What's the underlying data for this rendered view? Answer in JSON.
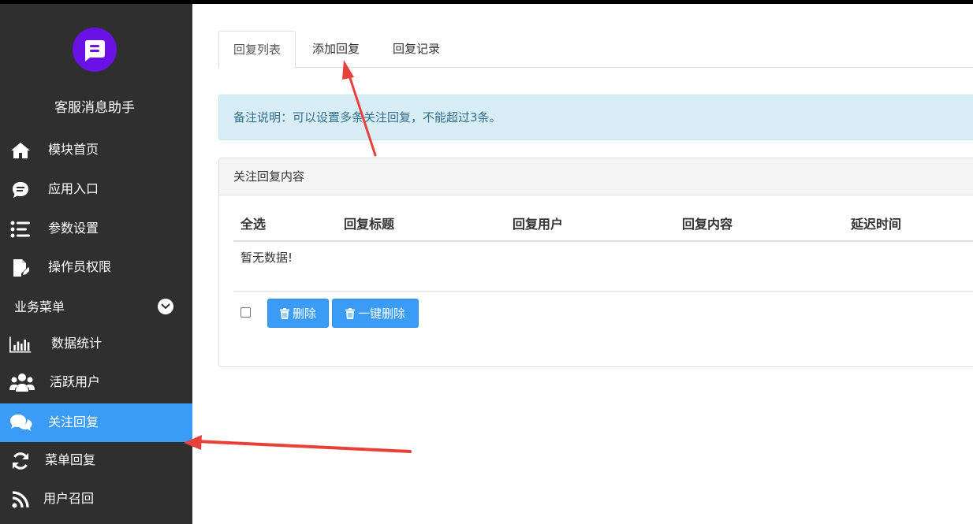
{
  "sidebar": {
    "app_name": "客服消息助手",
    "items": [
      {
        "label": "模块首页",
        "icon": "home-icon"
      },
      {
        "label": "应用入口",
        "icon": "chat-bubble-icon"
      },
      {
        "label": "参数设置",
        "icon": "list-settings-icon"
      },
      {
        "label": "操作员权限",
        "icon": "edit-document-icon"
      }
    ],
    "section_label": "业务菜单",
    "section_items": [
      {
        "label": "数据统计",
        "icon": "bar-chart-icon"
      },
      {
        "label": "活跃用户",
        "icon": "users-icon"
      },
      {
        "label": "关注回复",
        "icon": "comments-icon",
        "active": true
      },
      {
        "label": "菜单回复",
        "icon": "refresh-icon"
      },
      {
        "label": "用户召回",
        "icon": "rss-icon"
      }
    ]
  },
  "tabs": [
    {
      "label": "回复列表",
      "active": true
    },
    {
      "label": "添加回复"
    },
    {
      "label": "回复记录"
    }
  ],
  "alert_text": "备注说明：可以设置多条关注回复，不能超过3条。",
  "panel": {
    "title": "关注回复内容",
    "columns": [
      "全选",
      "回复标题",
      "回复用户",
      "回复内容",
      "延迟时间"
    ],
    "empty_text": "暂无数据!",
    "delete_label": "删除",
    "delete_all_label": "一键删除"
  },
  "colors": {
    "sidebar_bg": "#2f2f2f",
    "accent": "#3a9cf7",
    "logo": "#6a11e6",
    "alert_bg": "#d9edf7",
    "annotation_arrow": "#e8413c"
  }
}
